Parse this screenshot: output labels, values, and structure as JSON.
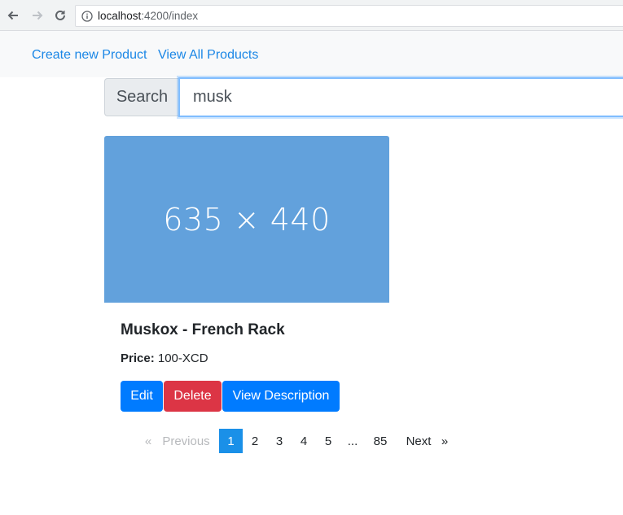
{
  "browser": {
    "url_host": "localhost",
    "url_rest": ":4200/index"
  },
  "nav": {
    "create_label": "Create new Product",
    "view_all_label": "View All Products"
  },
  "search": {
    "label": "Search",
    "value": "musk"
  },
  "product": {
    "image_placeholder_text": "635 × 440",
    "name": "Muskox - French Rack",
    "price_label": "Price:",
    "price_value": "100-XCD",
    "buttons": {
      "edit": "Edit",
      "delete": "Delete",
      "view": "View Description"
    }
  },
  "pagination": {
    "prev_arrow": "«",
    "previous": "Previous",
    "pages": [
      "1",
      "2",
      "3",
      "4",
      "5"
    ],
    "ellipsis": "...",
    "last": "85",
    "next": "Next",
    "next_arrow": "»",
    "current": "1"
  },
  "colors": {
    "accent": "#007bff",
    "danger": "#dc3545",
    "link": "#1b87e6",
    "image_placeholder": "#62a1dc",
    "active_page": "#1a90e8"
  }
}
